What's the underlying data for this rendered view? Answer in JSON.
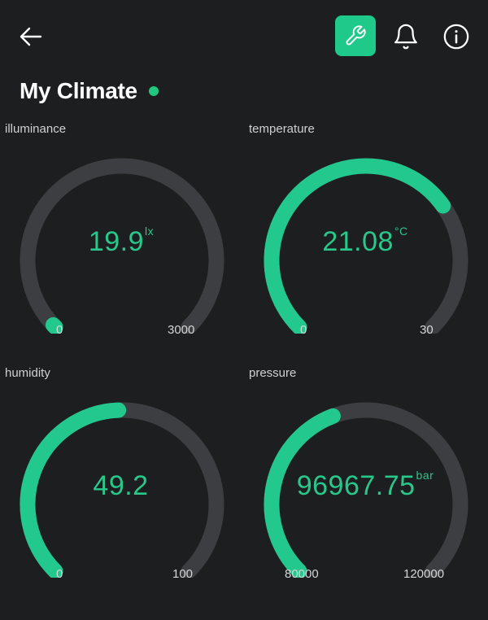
{
  "header": {
    "back_icon": "arrow-left-icon",
    "settings_icon": "wrench-icon",
    "notification_icon": "bell-icon",
    "info_icon": "info-circle-icon",
    "accent_color": "#1ec98a"
  },
  "page": {
    "title": "My Climate",
    "status": "online",
    "status_color": "#22c77f"
  },
  "gauges": [
    {
      "label": "illuminance",
      "value": "19.9",
      "unit": "lx",
      "min": "0",
      "max": "3000",
      "fraction": 0.0066
    },
    {
      "label": "temperature",
      "value": "21.08",
      "unit": "°C",
      "min": "0",
      "max": "30",
      "fraction": 0.7027
    },
    {
      "label": "humidity",
      "value": "49.2",
      "unit": "",
      "min": "0",
      "max": "100",
      "fraction": 0.492
    },
    {
      "label": "pressure",
      "value": "96967.75",
      "unit": "bar",
      "min": "80000",
      "max": "120000",
      "fraction": 0.4242
    }
  ],
  "colors": {
    "background": "#1d1e20",
    "track": "#3d3e41",
    "fill": "#22c88d"
  }
}
